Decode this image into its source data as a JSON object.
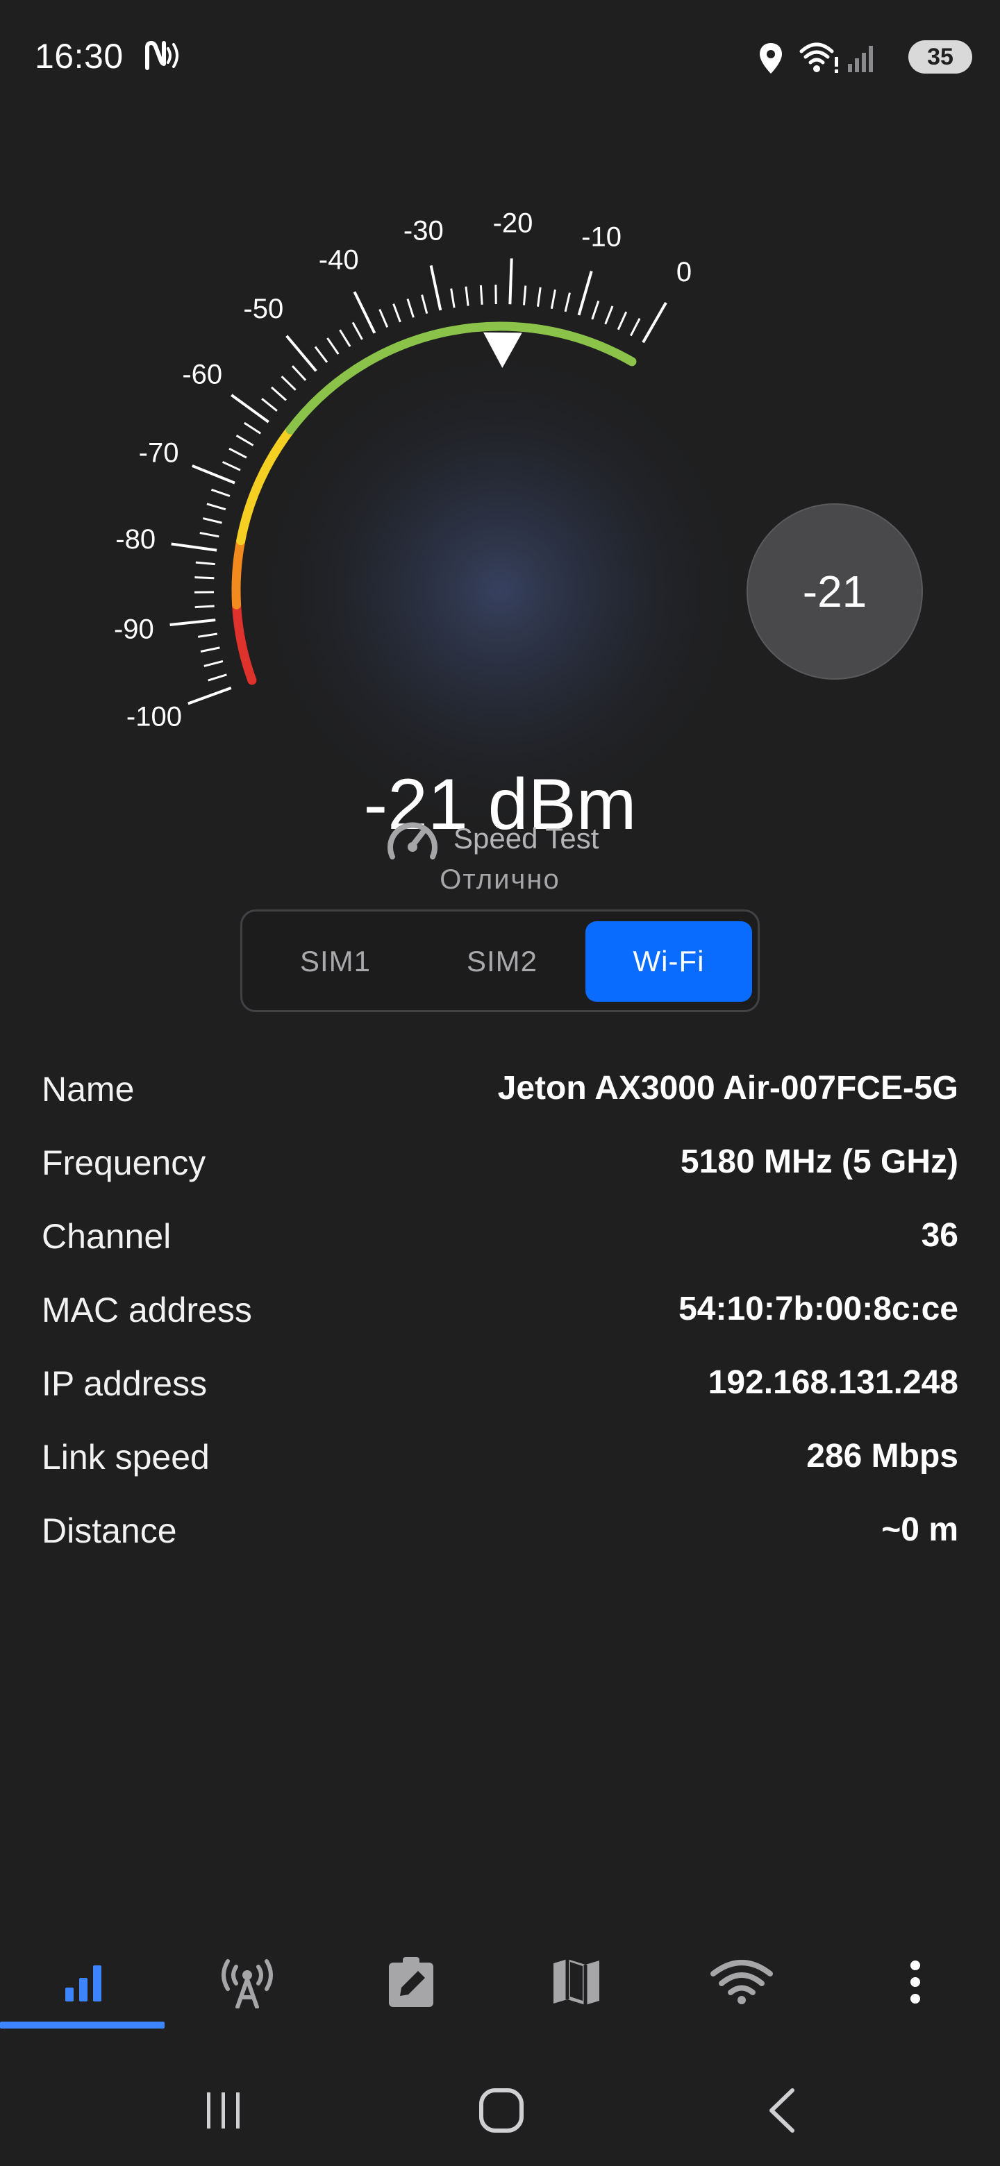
{
  "status_bar": {
    "time": "16:30",
    "battery": "35",
    "icons": [
      "nfc-icon",
      "location-icon",
      "wifi-icon",
      "cellular-signal-icon"
    ]
  },
  "gauge": {
    "scale_labels": [
      "-100",
      "-90",
      "-80",
      "-70",
      "-60",
      "-50",
      "-40",
      "-30",
      "-20",
      "-10",
      "0"
    ],
    "bubble_reading": "-21",
    "value_text": "-21 dBm",
    "quality_text": "Отлично",
    "signal_dbm": -21,
    "scale_min": -100,
    "scale_max": 0,
    "colors": {
      "red": "#e0322c",
      "orange": "#f28a1d",
      "yellow": "#f5d023",
      "green": "#8bc34a"
    }
  },
  "speed_test": {
    "label": "Speed Test",
    "icon": "speedometer-icon"
  },
  "tabs": {
    "sim1": "SIM1",
    "sim2": "SIM2",
    "wifi": "Wi-Fi",
    "selected": "Wi-Fi",
    "accent": "#0a6cff"
  },
  "info": {
    "rows": [
      {
        "label": "Name",
        "value": "Jeton AX3000 Air-007FCE-5G"
      },
      {
        "label": "Frequency",
        "value": "5180 MHz (5 GHz)"
      },
      {
        "label": "Channel",
        "value": "36"
      },
      {
        "label": "MAC address",
        "value": "54:10:7b:00:8c:ce"
      },
      {
        "label": "IP address",
        "value": "192.168.131.248"
      },
      {
        "label": "Link speed",
        "value": "286 Mbps"
      },
      {
        "label": "Distance",
        "value": "~0 m"
      }
    ]
  },
  "bottom_nav": {
    "items": [
      "signal-bars-icon",
      "cell-tower-icon",
      "edit-clipboard-icon",
      "map-icon",
      "wifi-icon",
      "more-vert-icon"
    ],
    "active": "signal-bars-icon",
    "accent": "#3d84ff"
  },
  "system_nav": [
    "recent-apps-icon",
    "home-icon",
    "back-icon"
  ]
}
